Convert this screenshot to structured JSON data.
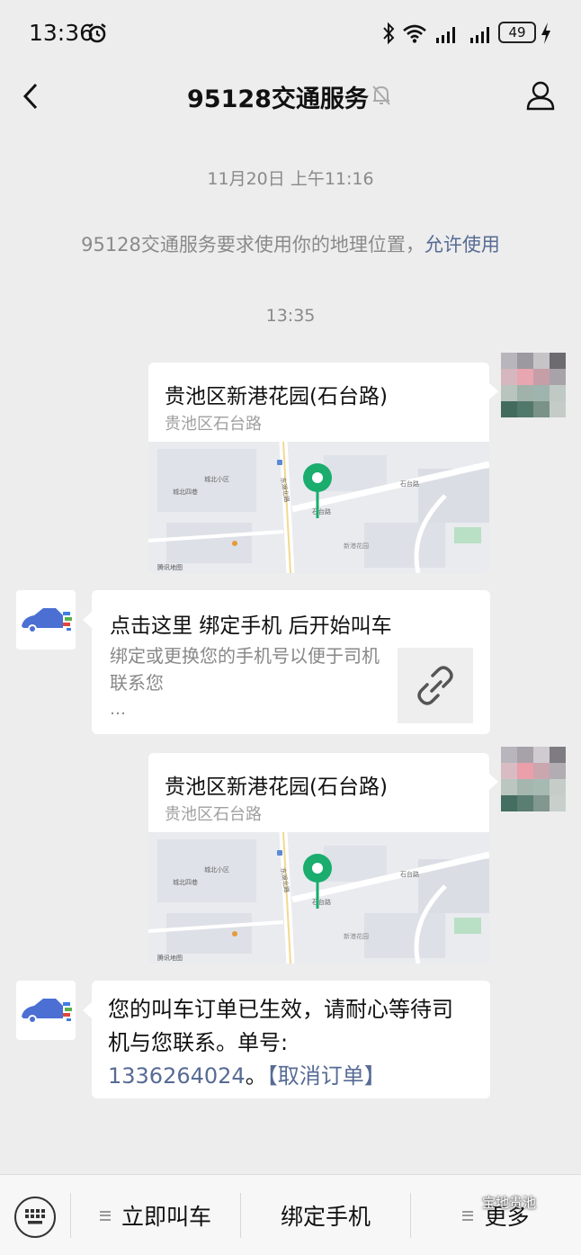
{
  "status_bar": {
    "time": "13:36",
    "battery": "49",
    "icons": [
      "alarm-icon",
      "bluetooth-icon",
      "wifi-icon",
      "signal-icon",
      "signal-icon",
      "charging-icon"
    ]
  },
  "nav": {
    "title": "95128交通服务",
    "icons": [
      "back-icon",
      "mute-icon",
      "profile-icon"
    ]
  },
  "chat": {
    "timestamp_1": "11月20日 上午11:16",
    "system_message": "95128交通服务要求使用你的地理位置，",
    "system_link": "允许使用",
    "timestamp_2": "13:35",
    "location_1": {
      "title": "贵池区新港花园(石台路)",
      "subtitle": "贵池区石台路"
    },
    "link_card": {
      "title": "点击这里 绑定手机 后开始叫车",
      "description": "绑定或更换您的手机号以便于司机联系您",
      "more": "…",
      "icon": "link-icon"
    },
    "location_2": {
      "title": "贵池区新港花园(石台路)",
      "subtitle": "贵池区石台路"
    },
    "order_message": {
      "text": "您的叫车订单已生效，请耐心等待司机与您联系。单号:",
      "order_number": "1336264024",
      "separator": "。",
      "cancel": "【取消订单】"
    }
  },
  "map_labels": {
    "road_1": "石台路",
    "road_2": "东湖北路",
    "community": "新港花园",
    "area_1": "城北小区",
    "area_2": "城北四巷",
    "provider": "腾讯地图"
  },
  "bottom_menu": {
    "items": [
      "立即叫车",
      "绑定手机",
      "更多"
    ],
    "icons": [
      "keyboard-icon",
      "menu-lines-icon"
    ]
  },
  "watermark": "宝地贵池",
  "colors": {
    "background": "#ededed",
    "link": "#576b95",
    "pin": "#1aad6e"
  }
}
